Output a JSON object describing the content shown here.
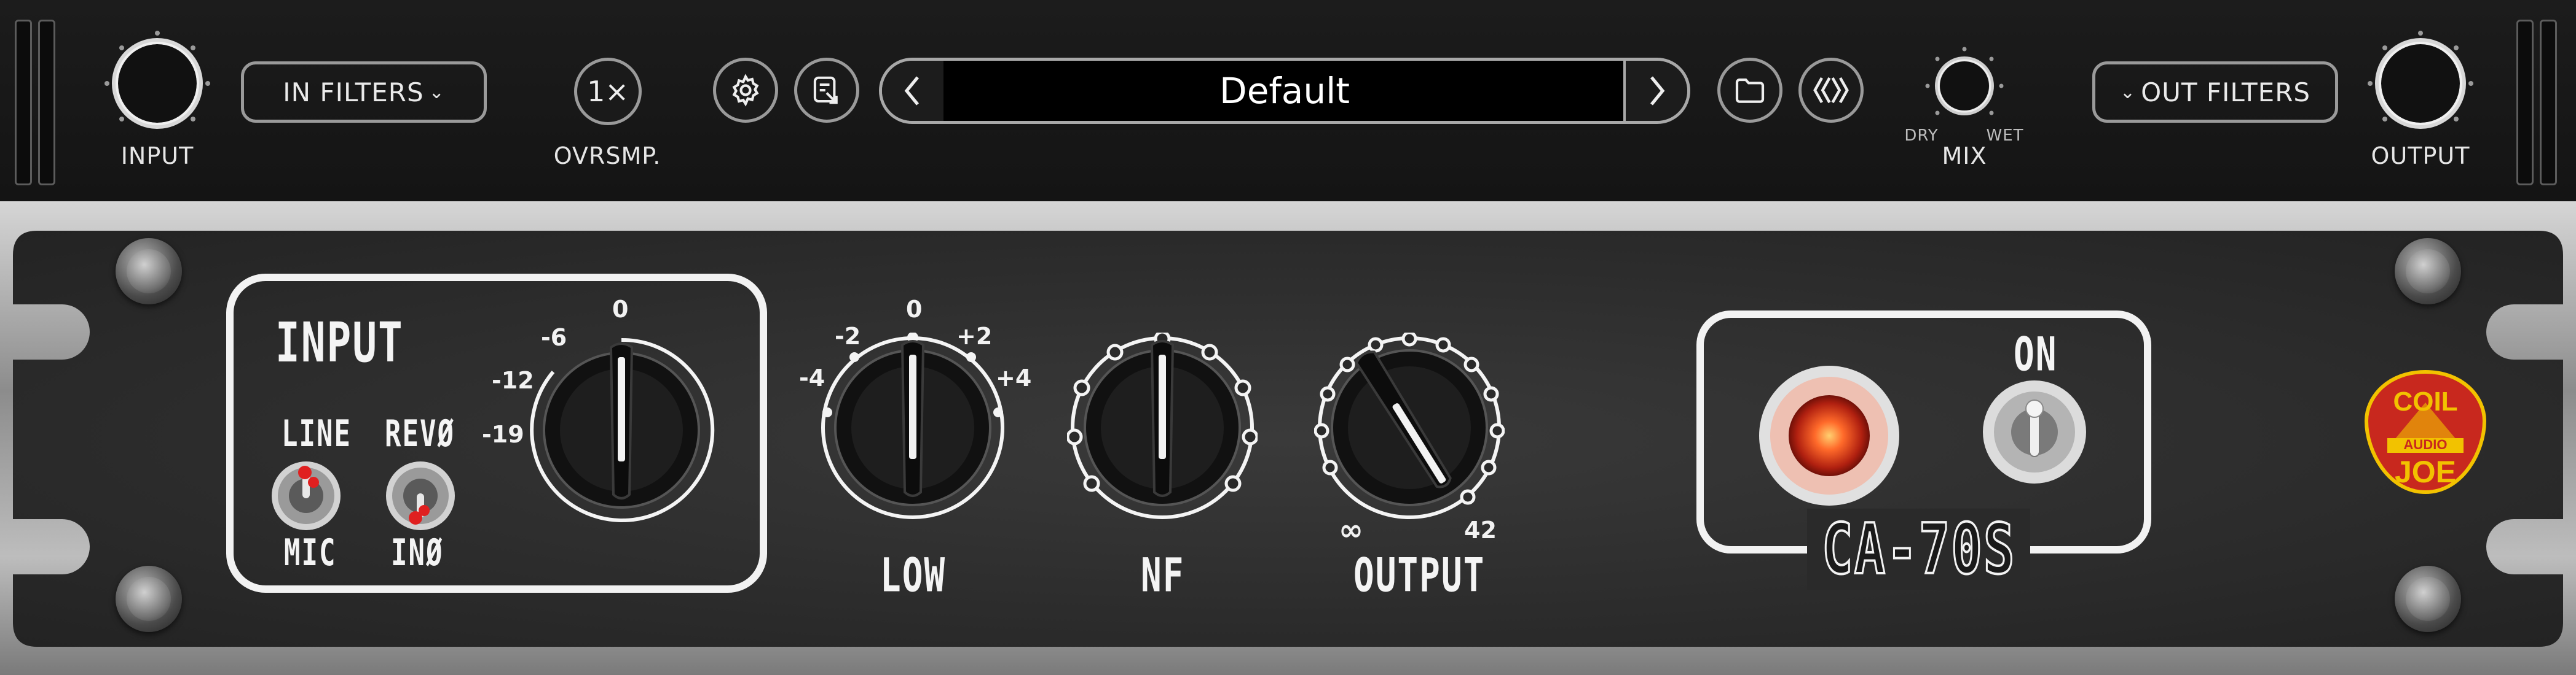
{
  "top_bar": {
    "input_knob_label": "INPUT",
    "in_filters_label": "IN FILTERS",
    "oversampling_value": "1×",
    "oversampling_label": "OVRSMP.",
    "preset_name": "Default",
    "mix_dry": "DRY",
    "mix_wet": "WET",
    "mix_label": "MIX",
    "out_filters_label": "OUT FILTERS",
    "output_knob_label": "OUTPUT"
  },
  "device": {
    "input_section": {
      "title": "INPUT",
      "switch1_top": "LINE",
      "switch1_bottom": "MIC",
      "switch2_top": "REVØ",
      "switch2_bottom": "INØ",
      "gain_ticks": [
        "-19",
        "-12",
        "-6",
        "0"
      ]
    },
    "low_knob": {
      "label": "LOW",
      "ticks": [
        "-4",
        "-2",
        "0",
        "+2",
        "+4"
      ]
    },
    "nf_knob": {
      "label": "NF"
    },
    "output_knob": {
      "label": "OUTPUT",
      "tick_min": "∞",
      "tick_max": "42"
    },
    "power_section": {
      "toggle_label": "ON",
      "model_name": "CA-70S"
    },
    "brand": {
      "line1": "COIL",
      "line2": "AUDIO",
      "line3": "JOE"
    }
  },
  "colors": {
    "topbar": "#161616",
    "pill_border": "#9a9a9a",
    "faceplate": "#2c2c2c",
    "lamp": "#ff6a2a",
    "switch_tip": "#e02020",
    "logo_red": "#c8281e",
    "logo_gold": "#f2c200"
  },
  "icons": [
    "gear-icon",
    "export-icon",
    "folder-icon",
    "compare-icon",
    "chevron-left-icon",
    "chevron-right-icon",
    "chevron-down-icon"
  ]
}
